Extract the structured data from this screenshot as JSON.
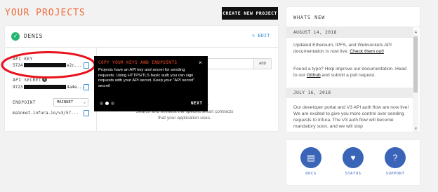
{
  "header": {
    "title": "YOUR PROJECTS",
    "create_button": "CREATE NEW PROJECT"
  },
  "project": {
    "name": "DENIS",
    "edit_label": "EDIT",
    "api_key_label": "API KEY",
    "api_key_prefix": "5724",
    "api_key_suffix": "e2c...",
    "api_secret_label": "API SECRET",
    "api_secret_prefix": "9723",
    "api_secret_suffix": "4a4e...",
    "endpoint_label": "ENDPOINT",
    "endpoint_select": "MAINNET",
    "endpoint_url": "mainnet.infura.io/v3/57...",
    "add_button": "ADD",
    "contracts_link": "ntracts",
    "contracts_desc": "Search and whitelist the specific smart contracts that your application uses."
  },
  "tooltip": {
    "title": "COPY YOUR KEYS AND ENDPOINTS",
    "close": "×",
    "body": "Projects have an API key and secret for sending requests. Using HTTPS/TLS basic auth you can sign requests with your API secret. Keep your \"API secret\" secret!",
    "next": "NEXT"
  },
  "news": {
    "title": "WHATS NEW",
    "entries": [
      {
        "date": "AUGUST 14, 2018",
        "text1": "Updated Ethereum, IPFS, and Websockets API documentation is now live.",
        "link1": "Check them out!",
        "text2": "Found a typo? Help improve our documentation. Head to our",
        "link2": "Github",
        "text3": "and submit a pull request."
      },
      {
        "date": "JULY 16, 2018",
        "text1": "Our developer portal and V3 API auth flow are now live! We are excited to give you more control over sending requests to Infura. The V3 auth flow will become mandatory soon, and we will stop"
      }
    ]
  },
  "support": {
    "docs": "DOCS",
    "status": "STATUS",
    "support": "SUPPORT"
  },
  "colors": {
    "accent": "#f06a3a",
    "link": "#3a8fd6",
    "support_blue": "#3a64b8",
    "highlight_red": "#e8121b"
  }
}
